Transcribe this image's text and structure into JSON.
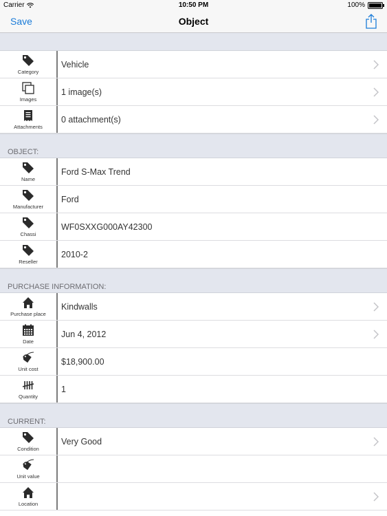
{
  "status_bar": {
    "carrier": "Carrier",
    "time": "10:50 PM",
    "battery": "100%"
  },
  "nav": {
    "save_label": "Save",
    "title": "Object"
  },
  "general_rows": [
    {
      "icon": "tag-icon",
      "label": "Category",
      "value": "Vehicle",
      "chevron": true
    },
    {
      "icon": "images-icon",
      "label": "Images",
      "value": "1 image(s)",
      "chevron": true
    },
    {
      "icon": "attachment-icon",
      "label": "Attachments",
      "value": "0 attachment(s)",
      "chevron": true
    }
  ],
  "object_section": {
    "header": "OBJECT:",
    "rows": [
      {
        "icon": "tag-icon",
        "label": "Name",
        "value": "Ford S-Max Trend"
      },
      {
        "icon": "tag-icon",
        "label": "Manufacturer",
        "value": "Ford"
      },
      {
        "icon": "tag-icon",
        "label": "Chassi",
        "value": "WF0SXXG000AY42300"
      },
      {
        "icon": "tag-icon",
        "label": "Reseller",
        "value": "2010-2"
      }
    ]
  },
  "purchase_section": {
    "header": "PURCHASE INFORMATION:",
    "rows": [
      {
        "icon": "house-icon",
        "label": "Purchase place",
        "value": "Kindwalls",
        "chevron": true
      },
      {
        "icon": "calendar-icon",
        "label": "Date",
        "value": "Jun 4, 2012",
        "chevron": true
      },
      {
        "icon": "price-tag-icon",
        "label": "Unit cost",
        "value": "$18,900.00"
      },
      {
        "icon": "tally-icon",
        "label": "Quantity",
        "value": "1"
      }
    ]
  },
  "current_section": {
    "header": "CURRENT:",
    "rows": [
      {
        "icon": "tag-icon",
        "label": "Condition",
        "value": "Very Good",
        "chevron": true
      },
      {
        "icon": "price-tag-icon",
        "label": "Unit value",
        "value": ""
      },
      {
        "icon": "house-icon",
        "label": "Location",
        "value": "",
        "chevron": true
      }
    ]
  },
  "colors": {
    "accent": "#1a7bd8",
    "section_bg": "#e3e6ee",
    "divider": "#7b7b7b"
  }
}
